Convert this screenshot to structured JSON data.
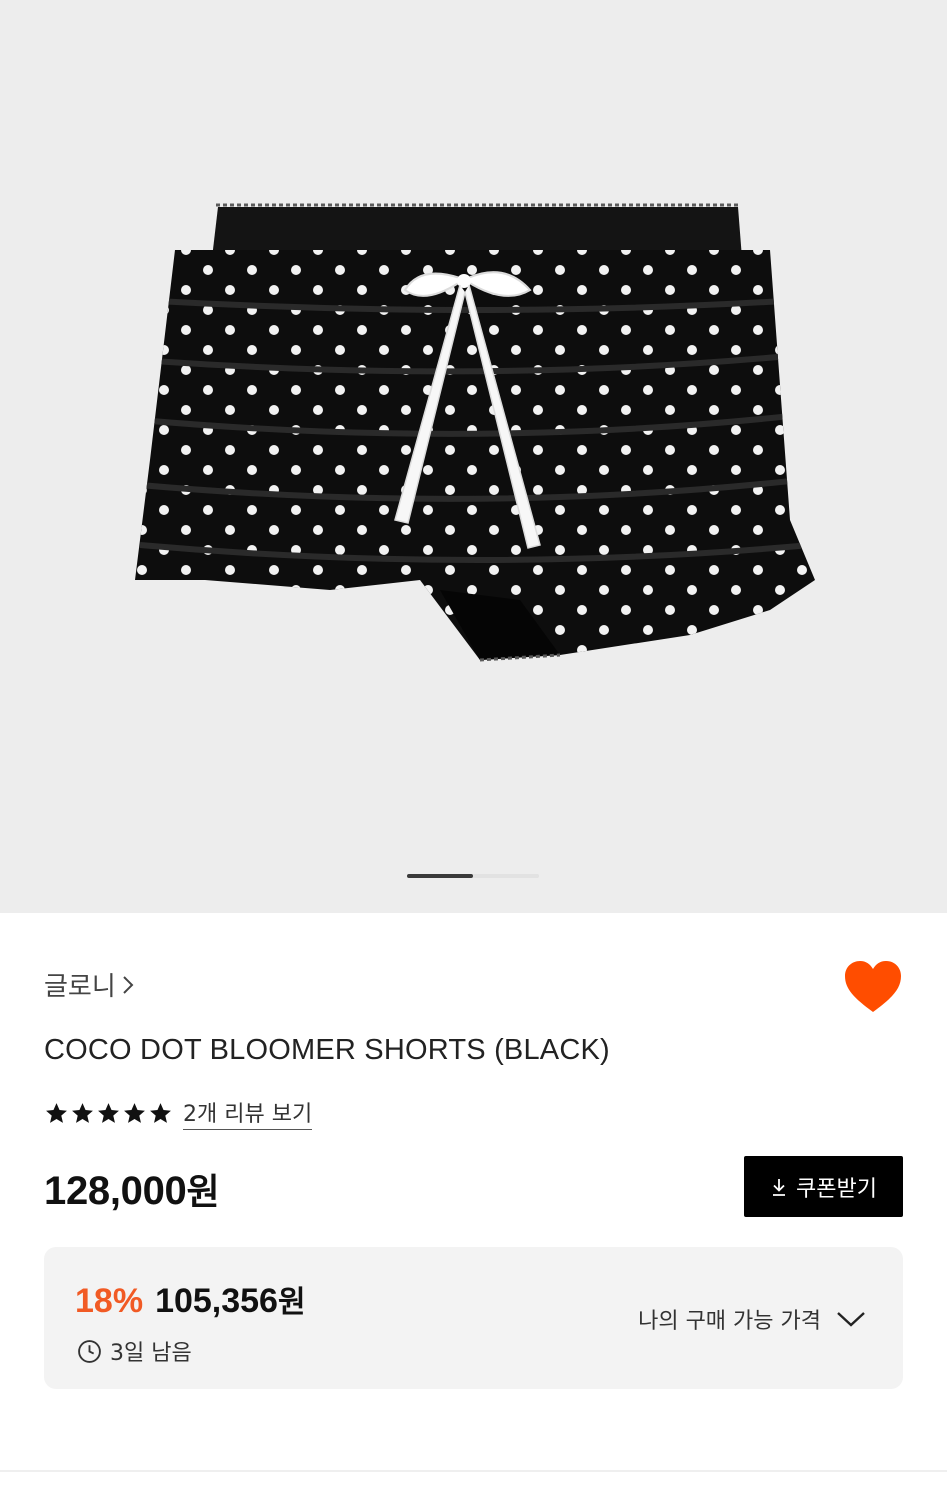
{
  "gallery": {
    "image_alt": "",
    "current_slide": 1,
    "total_slides": 2
  },
  "product": {
    "brand": "글로니",
    "title": "COCO DOT BLOOMER SHORTS (BLACK)",
    "rating_stars": 5,
    "review_link": "2개 리뷰 보기",
    "price_number": "128,000",
    "price_unit": "원",
    "coupon_label": "쿠폰받기",
    "liked": true
  },
  "benefit": {
    "discount_rate": "18%",
    "sale_price_number": "105,356",
    "sale_price_unit": "원",
    "time_left": "3일 남음",
    "my_price_label": "나의 구매 가능 가격"
  },
  "colors": {
    "accent": "#f15a24",
    "heart": "#ff4d00",
    "button_bg": "#000000",
    "gallery_bg": "#ededed",
    "box_bg": "#f3f3f3"
  },
  "icons": [
    "chevron-right-icon",
    "heart-icon",
    "star-icon",
    "download-icon",
    "clock-icon",
    "chevron-down-icon"
  ]
}
